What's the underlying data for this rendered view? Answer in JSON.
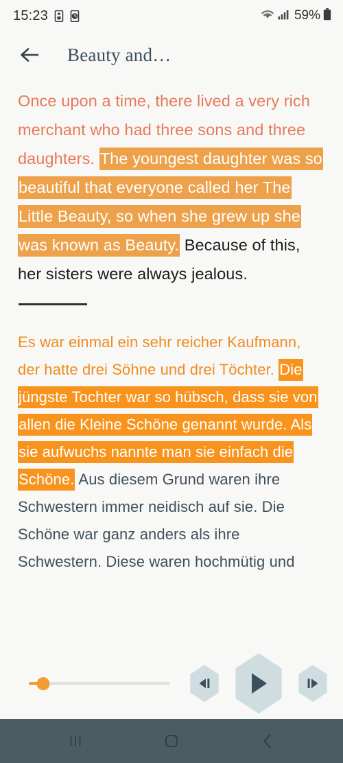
{
  "status_bar": {
    "time": "15:23",
    "battery_percent": "59%",
    "icons": [
      "sim-card-icon",
      "alarm-icon",
      "wifi-icon",
      "signal-bars-icon",
      "battery-icon"
    ]
  },
  "header": {
    "back_label": "back-arrow",
    "title": "Beauty and…"
  },
  "reader": {
    "english": {
      "pending": "Once upon a time, there lived a very rich merchant who had three sons and three daughters. ",
      "highlighted": "The youngest daughter was so beautiful that everyone called her The Little Beauty, so when she grew up she was known as Beauty.",
      "done": " Because of this, her sisters were always jealous."
    },
    "german": {
      "pending": "Es war einmal ein sehr reicher Kaufmann, der hatte drei Söhne und drei Töchter. ",
      "highlighted": "Die jüngste Tochter war so hübsch, dass sie von allen die Kleine Schöne genannt wurde. Als sie aufwuchs nannte man sie einfach die Schöne.",
      "done": " Aus diesem Grund waren ihre Schwestern immer neidisch auf sie. Die Schöne war ganz anders als ihre Schwestern. Diese waren hochmütig und"
    }
  },
  "player": {
    "progress_percent": "10",
    "previous_label": "previous-sentence",
    "play_label": "play",
    "next_label": "next-sentence"
  },
  "navbar": {
    "recents_label": "recent-apps",
    "home_label": "home",
    "back_label": "back"
  },
  "colors": {
    "page_background": "#f8f8f6",
    "english_text": "#e8795a",
    "english_highlight": "#eda14a",
    "german_text": "#ef8c21",
    "german_highlight": "#f8941d",
    "english_done_text": "#1b1b1b",
    "german_done_text": "#3f4f5a",
    "title_text": "#3d4f5c",
    "slider_accent": "#f39c33",
    "control_button": "#cfdde1",
    "control_glyph": "#3b505c",
    "navbar_background": "#4b5c63"
  }
}
